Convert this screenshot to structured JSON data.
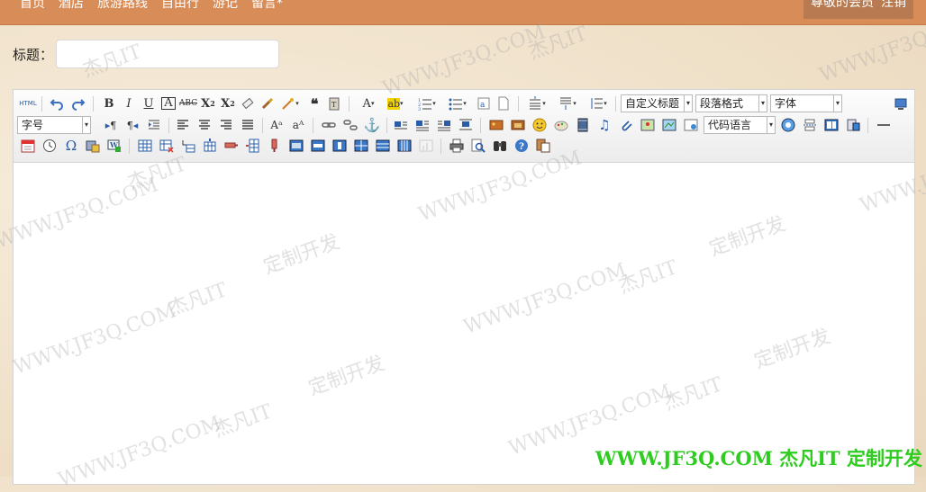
{
  "nav": {
    "items": [
      "首页",
      "酒店",
      "旅游路线",
      "自由行",
      "游记",
      "留言*"
    ]
  },
  "user": {
    "greeting": "尊敬的会员",
    "logout": "注销"
  },
  "form": {
    "title_label": "标题：",
    "title_value": ""
  },
  "toolbar": {
    "custom_heading": "自定义标题",
    "paragraph_format": "段落格式",
    "font_family": "字体",
    "font_size": "字号",
    "code_language": "代码语言",
    "icons": {
      "row1": [
        "html-source-icon",
        "undo-icon",
        "redo-icon",
        "bold-icon",
        "italic-icon",
        "underline-icon",
        "font-border-icon",
        "strikethrough-icon",
        "superscript-icon",
        "subscript-icon",
        "remove-format-icon",
        "format-match-icon",
        "auto-typeset-icon",
        "blockquote-icon",
        "paste-plain-icon",
        "font-color-icon",
        "background-color-icon",
        "ordered-list-icon",
        "unordered-list-icon",
        "select-all-icon",
        "clear-doc-icon",
        "row-spacing-top-icon",
        "row-spacing-bottom-icon",
        "line-height-icon",
        "fullscreen-icon"
      ],
      "row2": [
        "ltr-icon",
        "rtl-icon",
        "indent-icon",
        "justify-left-icon",
        "justify-center-icon",
        "justify-right-icon",
        "justify-full-icon",
        "uppercase-icon",
        "lowercase-icon",
        "link-icon",
        "unlink-icon",
        "anchor-icon",
        "image-none-icon",
        "image-left-icon",
        "image-right-icon",
        "image-center-icon",
        "simple-upload-icon",
        "insert-image-icon",
        "emotion-icon",
        "scrawl-icon",
        "insert-video-icon",
        "music-icon",
        "attachment-icon",
        "map-icon",
        "gmap-icon",
        "insert-frame-icon",
        "insert-code-icon",
        "webapp-icon",
        "pagebreak-icon",
        "template-icon",
        "horizontal-icon"
      ],
      "row3": [
        "date-icon",
        "time-icon",
        "special-char-icon",
        "wordimage-icon",
        "snapscreen-icon",
        "insert-table-icon",
        "delete-table-icon",
        "insert-paragraph-icon",
        "insert-row-icon",
        "delete-row-icon",
        "insert-col-icon",
        "delete-col-icon",
        "merge-cells-icon",
        "merge-right-icon",
        "merge-down-icon",
        "split-to-cells-icon",
        "split-to-rows-icon",
        "split-to-cols-icon",
        "charts-icon",
        "print-icon",
        "preview-icon",
        "search-replace-icon",
        "help-icon",
        "drafts-icon"
      ]
    }
  },
  "watermark": {
    "text_url": "WWW.JF3Q.COM",
    "text_brand": "杰凡IT",
    "text_slogan": "定制开发",
    "footer": "WWW.JF3Q.COM  杰凡IT   定制开发",
    "footer_color": "#2ecc1f"
  },
  "colors": {
    "topbar": "#d88c58",
    "userbox": "#b87b51",
    "background": "#f3e6d2"
  }
}
